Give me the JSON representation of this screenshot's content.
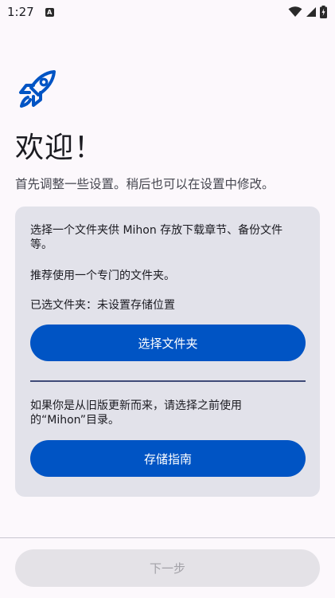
{
  "status_bar": {
    "time": "1:27",
    "notification_icon": "A"
  },
  "welcome": {
    "title": "欢迎！",
    "subtitle": "首先调整一些设置。稍后也可以在设置中修改。"
  },
  "storage_card": {
    "description": "选择一个文件夹供 Mihon 存放下载章节、备份文件等。",
    "recommendation": "推荐使用一个专门的文件夹。",
    "selected_folder": "已选文件夹：未设置存储位置",
    "select_folder_label": "选择文件夹",
    "migration_note": "如果你是从旧版更新而来，请选择之前使用的“Mihon”目录。",
    "storage_guide_label": "存储指南"
  },
  "footer": {
    "next_label": "下一步"
  },
  "colors": {
    "accent": "#0054c4",
    "card_background": "#e2e2ea",
    "page_background": "#fcf8fc"
  }
}
